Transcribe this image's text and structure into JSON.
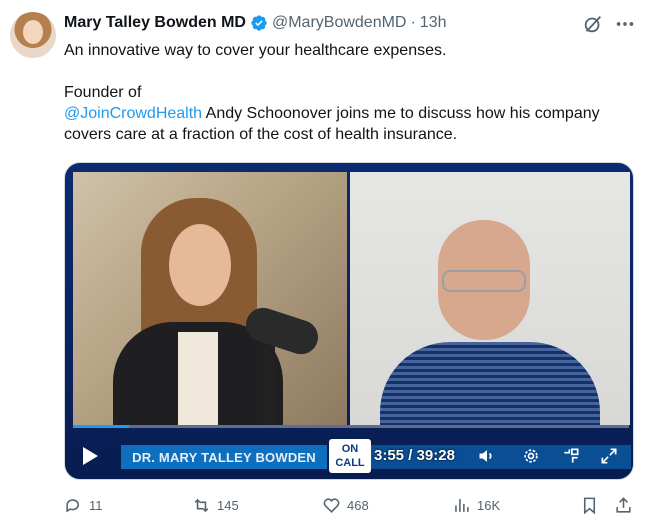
{
  "tweet": {
    "author": {
      "display_name": "Mary Talley Bowden MD",
      "handle": "@MaryBowdenMD",
      "separator": "·",
      "time": "13h",
      "verified": true
    },
    "text": {
      "line1": "An innovative way to cover your healthcare expenses.",
      "line2": "Founder of",
      "mention": "@JoinCrowdHealth",
      "line3_rest": " Andy Schoonover joins me to discuss how his company",
      "line4": "covers care at a fraction of the cost of health insurance."
    },
    "video": {
      "lower_third_name": "DR. MARY TALLEY BOWDEN",
      "channel_badge_line1": "ON",
      "channel_badge_line2": "CALL",
      "current_time": "3:55",
      "time_separator": "/",
      "duration": "39:28",
      "progress_fraction": 0.1
    },
    "actions": {
      "replies": "11",
      "reposts": "145",
      "likes": "468",
      "views": "16K"
    }
  },
  "colors": {
    "accent": "#1d9bf0",
    "secondary_text": "#536471",
    "primary_text": "#0f1419",
    "video_banner": "#0e6fbf"
  },
  "icons": [
    "verified-badge-icon",
    "grok-icon",
    "more-icon",
    "play-icon",
    "volume-icon",
    "settings-icon",
    "minimize-icon",
    "fullscreen-icon",
    "reply-icon",
    "repost-icon",
    "like-icon",
    "views-icon",
    "bookmark-icon",
    "share-icon"
  ]
}
